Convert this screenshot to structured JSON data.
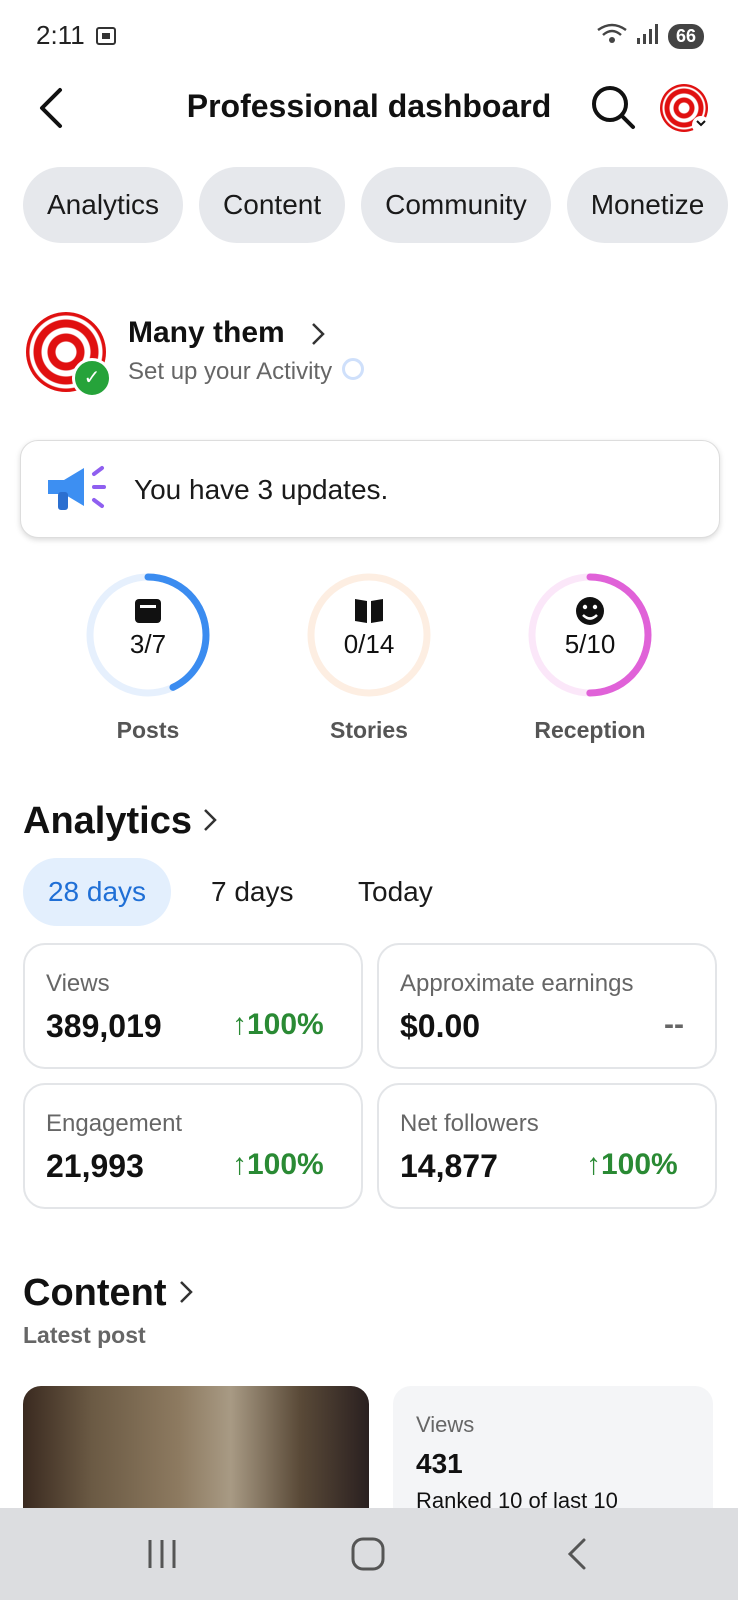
{
  "status_bar": {
    "time": "2:11",
    "battery": "66"
  },
  "header": {
    "title": "Professional dashboard"
  },
  "chips": [
    "Analytics",
    "Content",
    "Community",
    "Monetize"
  ],
  "profile": {
    "name": "Many them",
    "subtitle": "Set up your Activity"
  },
  "update_banner": {
    "text": "You have 3 updates."
  },
  "progress_rings": [
    {
      "label": "Posts",
      "value": "3/7",
      "fraction": 0.4286,
      "color": "#3b8cf0",
      "track": "#e6f0fd"
    },
    {
      "label": "Stories",
      "value": "0/14",
      "fraction": 0,
      "color": "#f39a4a",
      "track": "#fdeee2"
    },
    {
      "label": "Reception",
      "value": "5/10",
      "fraction": 0.5,
      "color": "#e062d8",
      "track": "#fbe7f9"
    }
  ],
  "analytics": {
    "title": "Analytics",
    "periods": [
      "28 days",
      "7 days",
      "Today"
    ],
    "metrics": [
      {
        "label": "Views",
        "value": "389,019",
        "change": "100%"
      },
      {
        "label": "Approximate earnings",
        "value": "$0.00",
        "change": "--"
      },
      {
        "label": "Engagement",
        "value": "21,993",
        "change": "100%"
      },
      {
        "label": "Net followers",
        "value": "14,877",
        "change": "100%"
      }
    ]
  },
  "content": {
    "title": "Content",
    "latest_label": "Latest post",
    "post_stats": {
      "label": "Views",
      "value": "431",
      "rank": "Ranked 10 of last 10"
    }
  },
  "colors": {
    "accent_blue": "#1f6fd6",
    "positive_green": "#2a8a34",
    "chip_bg": "#e6e8ec"
  }
}
